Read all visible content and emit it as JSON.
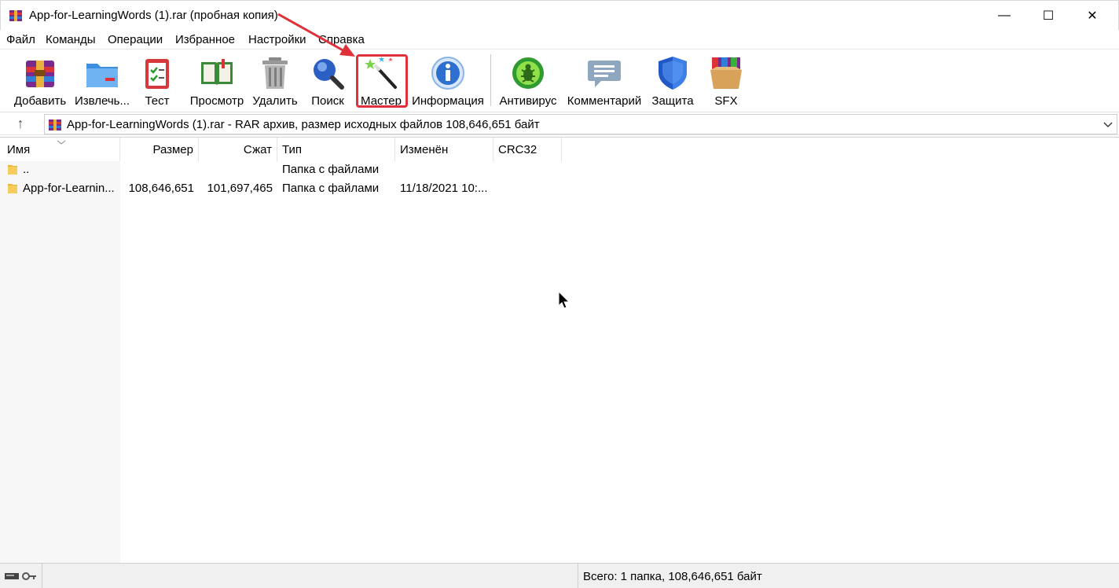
{
  "window": {
    "title": "App-for-LearningWords (1).rar (пробная копия)",
    "minimize_glyph": "—",
    "maximize_glyph": "☐",
    "close_glyph": "✕"
  },
  "menu": [
    "Файл",
    "Команды",
    "Операции",
    "Избранное",
    "Настройки",
    "Справка"
  ],
  "toolbar": {
    "buttons": [
      {
        "label": "Добавить",
        "icon": "add-archive-icon"
      },
      {
        "label": "Извлечь...",
        "icon": "extract-folder-icon"
      },
      {
        "label": "Тест",
        "icon": "test-clipboard-icon"
      },
      {
        "label": "Просмотр",
        "icon": "view-book-icon"
      },
      {
        "label": "Удалить",
        "icon": "trash-icon"
      },
      {
        "label": "Поиск",
        "icon": "search-magnifier-icon"
      },
      {
        "label": "Мастер",
        "icon": "wizard-wand-icon"
      },
      {
        "label": "Информация",
        "icon": "info-icon"
      },
      {
        "label": "Антивирус",
        "icon": "antivirus-bug-icon"
      },
      {
        "label": "Комментарий",
        "icon": "comment-bubble-icon"
      },
      {
        "label": "Защита",
        "icon": "shield-icon"
      },
      {
        "label": "SFX",
        "icon": "sfx-box-icon"
      }
    ],
    "highlighted": "Мастер"
  },
  "address": {
    "text": "App-for-LearningWords (1).rar - RAR архив, размер исходных файлов 108,646,651 байт",
    "up_glyph": "↑"
  },
  "columns": [
    "Имя",
    "Размер",
    "Сжат",
    "Тип",
    "Изменён",
    "CRC32"
  ],
  "rows": [
    {
      "name": "..",
      "size": "",
      "packed": "",
      "type": "Папка с файлами",
      "modified": "",
      "crc": ""
    },
    {
      "name": "App-for-Learnin...",
      "size": "108,646,651",
      "packed": "101,697,465",
      "type": "Папка с файлами",
      "modified": "11/18/2021 10:...",
      "crc": ""
    }
  ],
  "status": {
    "summary": "Всего: 1 папка, 108,646,651 байт"
  },
  "colors": {
    "highlight_border": "#e0313a",
    "annotation_arrow": "#e0313a"
  }
}
